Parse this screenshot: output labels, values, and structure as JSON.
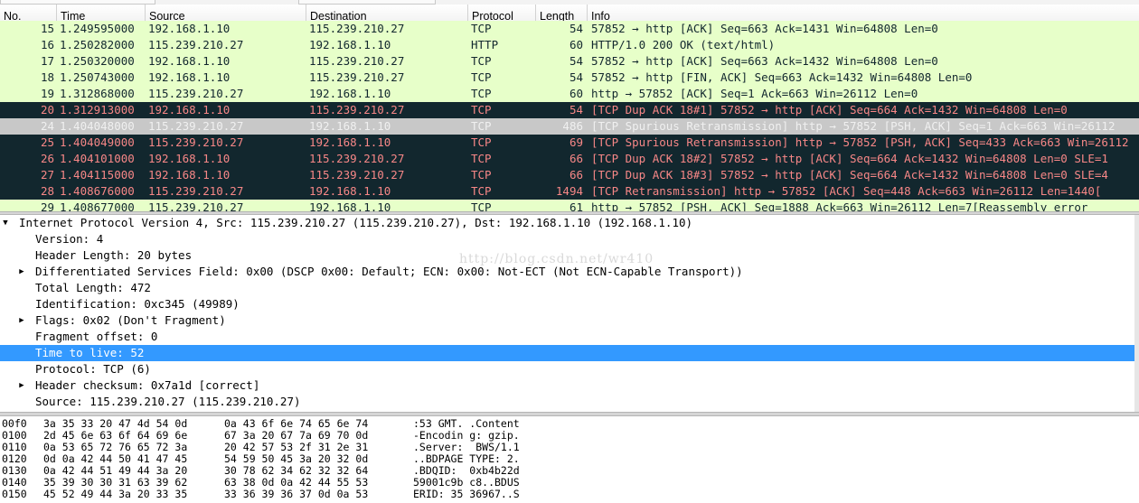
{
  "packet_list": {
    "columns": [
      "No.",
      "Time",
      "Source",
      "Destination",
      "Protocol",
      "Length",
      "Info"
    ],
    "rows": [
      {
        "no": "15",
        "time": "1.249595000",
        "src": "192.168.1.10",
        "dst": "115.239.210.27",
        "proto": "TCP",
        "len": "54",
        "info": "57852 → http [ACK] Seq=663 Ack=1431 Win=64808 Len=0",
        "bg": "#e7ffc9",
        "fg": "#12272e"
      },
      {
        "no": "16",
        "time": "1.250282000",
        "src": "115.239.210.27",
        "dst": "192.168.1.10",
        "proto": "HTTP",
        "len": "60",
        "info": "HTTP/1.0 200 OK  (text/html)",
        "bg": "#e7ffc9",
        "fg": "#12272e"
      },
      {
        "no": "17",
        "time": "1.250320000",
        "src": "192.168.1.10",
        "dst": "115.239.210.27",
        "proto": "TCP",
        "len": "54",
        "info": "57852 → http [ACK] Seq=663 Ack=1432 Win=64808 Len=0",
        "bg": "#e7ffc9",
        "fg": "#12272e"
      },
      {
        "no": "18",
        "time": "1.250743000",
        "src": "192.168.1.10",
        "dst": "115.239.210.27",
        "proto": "TCP",
        "len": "54",
        "info": "57852 → http [FIN, ACK] Seq=663 Ack=1432 Win=64808 Len=0",
        "bg": "#e7ffc9",
        "fg": "#12272e"
      },
      {
        "no": "19",
        "time": "1.312868000",
        "src": "115.239.210.27",
        "dst": "192.168.1.10",
        "proto": "TCP",
        "len": "60",
        "info": "http → 57852 [ACK] Seq=1 Ack=663 Win=26112 Len=0",
        "bg": "#e7ffc9",
        "fg": "#12272e"
      },
      {
        "no": "20",
        "time": "1.312913000",
        "src": "192.168.1.10",
        "dst": "115.239.210.27",
        "proto": "TCP",
        "len": "54",
        "info": "[TCP Dup ACK 18#1] 57852 → http [ACK] Seq=664 Ack=1432 Win=64808 Len=0",
        "bg": "#12272e",
        "fg": "#f78787"
      },
      {
        "no": "24",
        "time": "1.404048000",
        "src": "115.239.210.27",
        "dst": "192.168.1.10",
        "proto": "TCP",
        "len": "486",
        "info": "[TCP Spurious Retransmission] http → 57852 [PSH, ACK] Seq=1 Ack=663 Win=26112",
        "bg": "#c8c8c8",
        "fg": "#f0f0f0"
      },
      {
        "no": "25",
        "time": "1.404049000",
        "src": "115.239.210.27",
        "dst": "192.168.1.10",
        "proto": "TCP",
        "len": "69",
        "info": "[TCP Spurious Retransmission] http → 57852 [PSH, ACK] Seq=433 Ack=663 Win=26112",
        "bg": "#12272e",
        "fg": "#f78787"
      },
      {
        "no": "26",
        "time": "1.404101000",
        "src": "192.168.1.10",
        "dst": "115.239.210.27",
        "proto": "TCP",
        "len": "66",
        "info": "[TCP Dup ACK 18#2] 57852 → http [ACK] Seq=664 Ack=1432 Win=64808 Len=0 SLE=1",
        "bg": "#12272e",
        "fg": "#f78787"
      },
      {
        "no": "27",
        "time": "1.404115000",
        "src": "192.168.1.10",
        "dst": "115.239.210.27",
        "proto": "TCP",
        "len": "66",
        "info": "[TCP Dup ACK 18#3] 57852 → http [ACK] Seq=664 Ack=1432 Win=64808 Len=0 SLE=4",
        "bg": "#12272e",
        "fg": "#f78787"
      },
      {
        "no": "28",
        "time": "1.408676000",
        "src": "115.239.210.27",
        "dst": "192.168.1.10",
        "proto": "TCP",
        "len": "1494",
        "info": "[TCP Retransmission] http → 57852 [ACK] Seq=448 Ack=663 Win=26112 Len=1440[",
        "bg": "#12272e",
        "fg": "#f78787"
      },
      {
        "no": "29",
        "time": "1.408677000",
        "src": "115.239.210.27",
        "dst": "192.168.1.10",
        "proto": "TCP",
        "len": "61",
        "info": "http → 57852 [PSH, ACK] Seq=1888 Ack=663 Win=26112 Len=7[Reassembly error",
        "bg": "#e7ffc9",
        "fg": "#12272e"
      }
    ]
  },
  "detail": {
    "watermark": "http://blog.csdn.net/wr410",
    "items": [
      {
        "text": "Internet Protocol Version 4, Src: 115.239.210.27 (115.239.210.27), Dst: 192.168.1.10 (192.168.1.10)",
        "indent": 0,
        "arrow": "▼",
        "selected": false
      },
      {
        "text": "Version: 4",
        "indent": 1,
        "arrow": "",
        "selected": false
      },
      {
        "text": "Header Length: 20 bytes",
        "indent": 1,
        "arrow": "",
        "selected": false
      },
      {
        "text": "Differentiated Services Field: 0x00 (DSCP 0x00: Default; ECN: 0x00: Not-ECT (Not ECN-Capable Transport))",
        "indent": 1,
        "arrow": "▶",
        "selected": false
      },
      {
        "text": "Total Length: 472",
        "indent": 1,
        "arrow": "",
        "selected": false
      },
      {
        "text": "Identification: 0xc345 (49989)",
        "indent": 1,
        "arrow": "",
        "selected": false
      },
      {
        "text": "Flags: 0x02 (Don't Fragment)",
        "indent": 1,
        "arrow": "▶",
        "selected": false
      },
      {
        "text": "Fragment offset: 0",
        "indent": 1,
        "arrow": "",
        "selected": false
      },
      {
        "text": "Time to live: 52",
        "indent": 1,
        "arrow": "",
        "selected": true
      },
      {
        "text": "Protocol: TCP (6)",
        "indent": 1,
        "arrow": "",
        "selected": false
      },
      {
        "text": "Header checksum: 0x7a1d [correct]",
        "indent": 1,
        "arrow": "▶",
        "selected": false
      },
      {
        "text": "Source: 115.239.210.27 (115.239.210.27)",
        "indent": 1,
        "arrow": "",
        "selected": false
      }
    ]
  },
  "hex": {
    "rows": [
      {
        "off": "00f0",
        "b1": "3a 35 33 20 47 4d 54 0d",
        "b2": "0a 43 6f 6e 74 65 6e 74",
        "asc": ":53 GMT. .Content"
      },
      {
        "off": "0100",
        "b1": "2d 45 6e 63 6f 64 69 6e",
        "b2": "67 3a 20 67 7a 69 70 0d",
        "asc": "-Encodin g: gzip."
      },
      {
        "off": "0110",
        "b1": "0a 53 65 72 76 65 72 3a",
        "b2": "20 42 57 53 2f 31 2e 31",
        "asc": ".Server:  BWS/1.1"
      },
      {
        "off": "0120",
        "b1": "0d 0a 42 44 50 41 47 45",
        "b2": "54 59 50 45 3a 20 32 0d",
        "asc": "..BDPAGE TYPE: 2."
      },
      {
        "off": "0130",
        "b1": "0a 42 44 51 49 44 3a 20",
        "b2": "30 78 62 34 62 32 32 64",
        "asc": ".BDQID:  0xb4b22d"
      },
      {
        "off": "0140",
        "b1": "35 39 30 30 31 63 39 62",
        "b2": "63 38 0d 0a 42 44 55 53",
        "asc": "59001c9b c8..BDUS"
      },
      {
        "off": "0150",
        "b1": "45 52 49 44 3a 20 33 35",
        "b2": "33 36 39 36 37 0d 0a 53",
        "asc": "ERID: 35 36967..S"
      }
    ]
  }
}
